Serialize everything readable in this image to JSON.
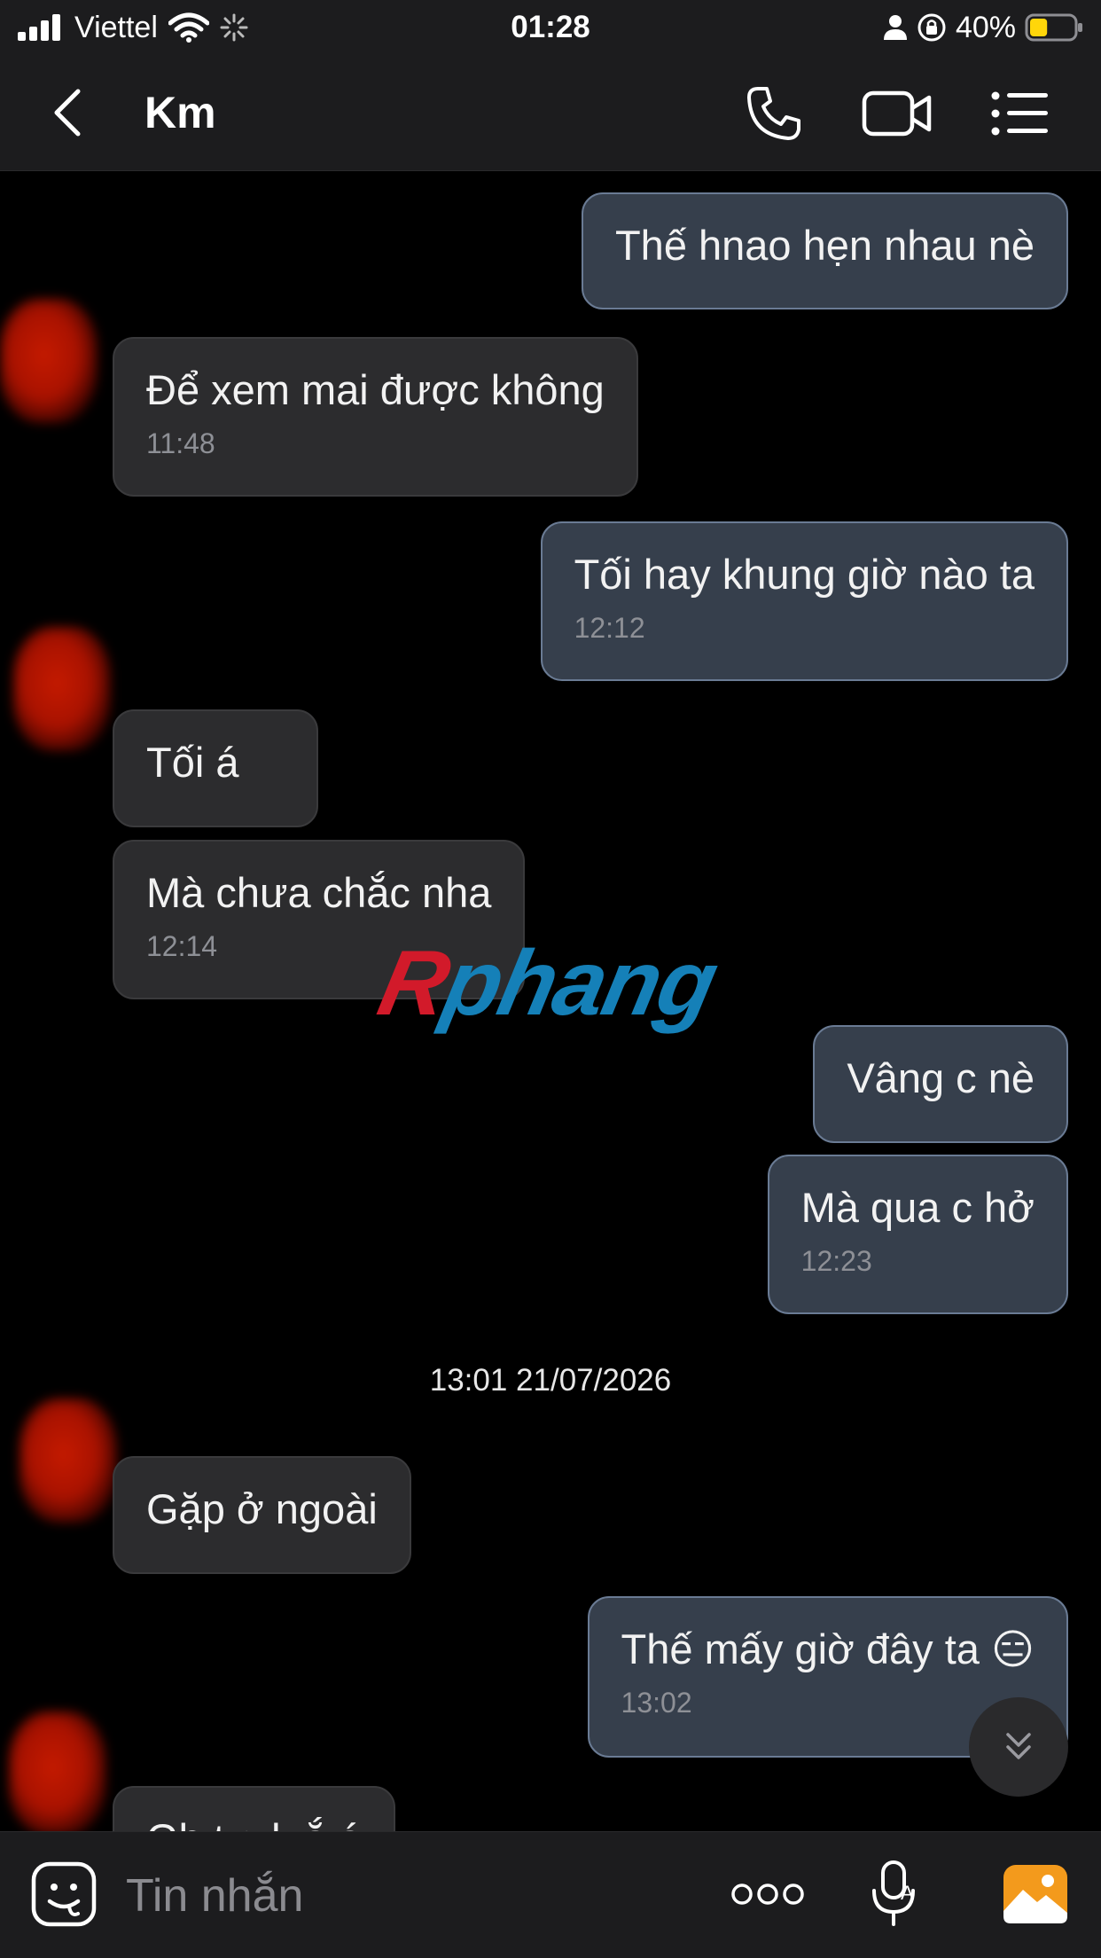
{
  "status_bar": {
    "carrier": "Viettel",
    "time": "01:28",
    "battery": "40%",
    "battery_level": 0.4
  },
  "header": {
    "title": "Km"
  },
  "messages": [
    {
      "side": "out",
      "text": "Thế hnao hẹn nhau nè",
      "time": ""
    },
    {
      "side": "in",
      "text": "Để xem mai được không",
      "time": "11:48"
    },
    {
      "side": "out",
      "text": "Tối hay khung giờ nào ta",
      "time": "12:12"
    },
    {
      "side": "in",
      "text": "Tối á",
      "time": ""
    },
    {
      "side": "in",
      "text": "Mà chưa chắc nha",
      "time": "12:14"
    },
    {
      "side": "out",
      "text": "Vâng c nè",
      "time": ""
    },
    {
      "side": "out",
      "text": "Mà qua c hở",
      "time": "12:23"
    },
    {
      "side": "in",
      "text": "Gặp ở ngoài",
      "time": ""
    },
    {
      "side": "out",
      "text": "Thế mấy giờ đây ta 😑",
      "time": "13:02"
    },
    {
      "side": "in",
      "text": "Gh t g k ắ á",
      "time": ""
    }
  ],
  "date_separator": "13:01 21/07/2026",
  "watermark": {
    "part1": "R",
    "part2": "phang"
  },
  "composer": {
    "placeholder": "Tin nhắn"
  },
  "colors": {
    "incoming_bubble": "#2c2c2e",
    "outgoing_bubble": "#363f4c",
    "outgoing_border": "#6a7b94",
    "image_button": "#f39a1c"
  }
}
